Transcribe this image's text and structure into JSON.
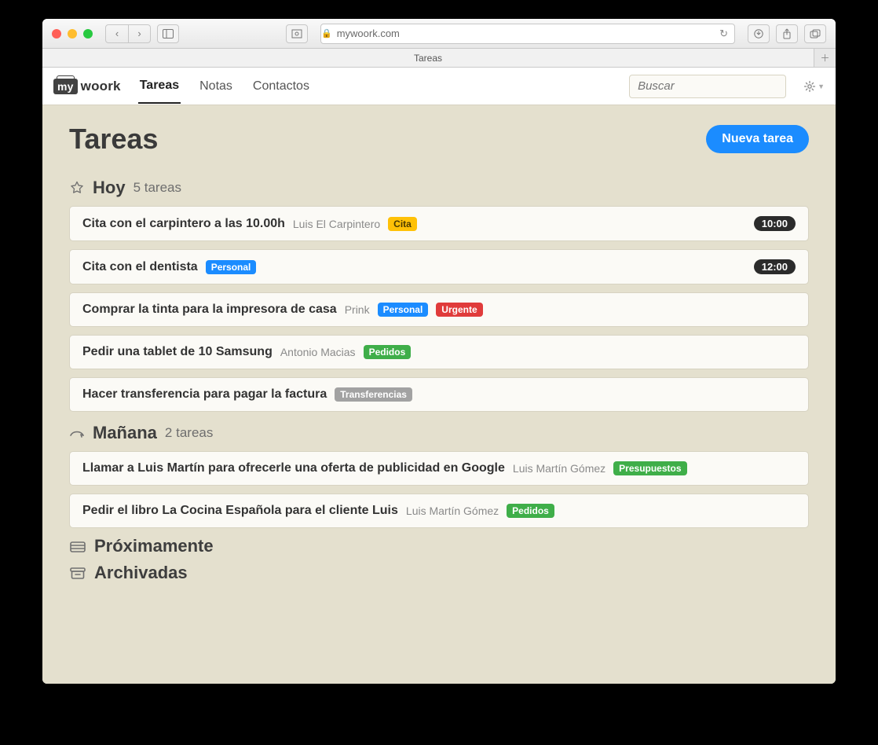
{
  "browser": {
    "url_host": "mywoork.com",
    "tab_title": "Tareas"
  },
  "app": {
    "logo_prefix": "my",
    "logo_text": "woork",
    "nav": {
      "tareas": "Tareas",
      "notas": "Notas",
      "contactos": "Contactos"
    },
    "search_placeholder": "Buscar"
  },
  "page": {
    "title": "Tareas",
    "new_task_label": "Nueva tarea"
  },
  "sections": {
    "today": {
      "title": "Hoy",
      "count": "5 tareas"
    },
    "tomorrow": {
      "title": "Mañana",
      "count": "2 tareas"
    },
    "upcoming": "Próximamente",
    "archived": "Archivadas"
  },
  "tasks_today": [
    {
      "title": "Cita con el carpintero a las 10.00h",
      "sub": "Luis El Carpintero",
      "tag1": "Cita",
      "tag1_class": "tag-yellow",
      "time": "10:00"
    },
    {
      "title": "Cita con el dentista",
      "tag1": "Personal",
      "tag1_class": "tag-blue",
      "time": "12:00"
    },
    {
      "title": "Comprar la tinta para la impresora de casa",
      "sub": "Prink",
      "tag1": "Personal",
      "tag1_class": "tag-blue",
      "tag2": "Urgente",
      "tag2_class": "tag-red"
    },
    {
      "title": "Pedir una tablet de 10 Samsung",
      "sub": "Antonio Macias",
      "tag1": "Pedidos",
      "tag1_class": "tag-green"
    },
    {
      "title": "Hacer transferencia para pagar la factura",
      "tag1": "Transferencias",
      "tag1_class": "tag-gray"
    }
  ],
  "tasks_tomorrow": [
    {
      "title": "Llamar a Luis Martín para ofrecerle una oferta de publicidad en Google",
      "sub": "Luis Martín Gómez",
      "tag1": "Presupuestos",
      "tag1_class": "tag-green"
    },
    {
      "title": "Pedir el libro La Cocina Española para el cliente Luis",
      "sub": "Luis Martín Gómez",
      "tag1": "Pedidos",
      "tag1_class": "tag-green"
    }
  ]
}
